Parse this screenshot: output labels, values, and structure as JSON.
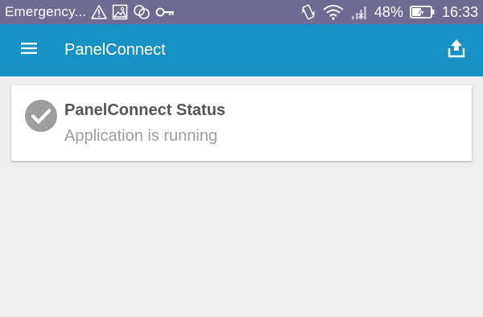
{
  "status_bar": {
    "carrier": "Emergency...",
    "battery_percent": "48%",
    "time": "16:33",
    "icons": [
      "warning-icon",
      "image-icon",
      "sync-icon",
      "key-icon",
      "vibrate-icon",
      "wifi-icon",
      "no-signal-icon",
      "battery-charging-icon"
    ]
  },
  "app_bar": {
    "title": "PanelConnect",
    "menu_icon": "menu-icon",
    "action_icon": "upload-icon"
  },
  "status_card": {
    "title": "PanelConnect Status",
    "subtitle": "Application is running",
    "icon": "check-circle-icon"
  },
  "colors": {
    "status_bar": "#6f6a94",
    "app_bar": "#1791c4",
    "background": "#eeeeee",
    "card": "#ffffff",
    "check_circle": "#9e9e9e"
  }
}
